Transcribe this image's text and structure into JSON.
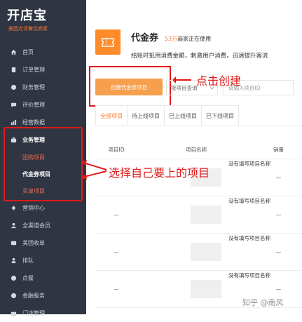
{
  "sidebar": {
    "logo": "开店宝",
    "logo_sub": "美团点评餐饮商家",
    "items": [
      {
        "label": "首页",
        "icon": "home-icon"
      },
      {
        "label": "订单管理",
        "icon": "order-icon"
      },
      {
        "label": "财务管理",
        "icon": "finance-icon"
      },
      {
        "label": "评价管理",
        "icon": "review-icon"
      },
      {
        "label": "经营数据",
        "icon": "chart-icon"
      },
      {
        "label": "业务管理",
        "icon": "business-icon"
      }
    ],
    "sub_items": [
      {
        "label": "团购项目"
      },
      {
        "label": "代金券项目"
      },
      {
        "label": "买单项目"
      }
    ],
    "items_after": [
      {
        "label": "营销中心",
        "icon": "marketing-icon"
      },
      {
        "label": "全渠道会员",
        "icon": "member-icon"
      },
      {
        "label": "美团收单",
        "icon": "pay-icon"
      },
      {
        "label": "排队",
        "icon": "queue-icon"
      },
      {
        "label": "点餐",
        "icon": "meal-icon"
      },
      {
        "label": "金融服务",
        "icon": "money-icon"
      },
      {
        "label": "门店管理",
        "icon": "store-icon"
      }
    ]
  },
  "header": {
    "title": "代金券",
    "count": "53万",
    "count_suffix": "商家正在使用",
    "desc": "结账时抵用消费金额，刺激用户消费，迅速提升客流"
  },
  "toolbar": {
    "create_label": "创建代金券项目",
    "status_select": "按项目查询",
    "id_placeholder": "请输入项目ID"
  },
  "tabs": [
    {
      "label": "全部项目",
      "active": true
    },
    {
      "label": "待上线项目"
    },
    {
      "label": "已上线项目"
    },
    {
      "label": "已下线项目"
    }
  ],
  "table": {
    "headers": [
      "项目ID",
      "项目名称",
      "销量"
    ],
    "rows": [
      {
        "id": "",
        "name": "没有填写项目名称",
        "sales": "—"
      },
      {
        "id": "—",
        "name": "没有填写项目名称",
        "sales": "—"
      },
      {
        "id": "—",
        "name": "没有填写项目名称",
        "sales": "—"
      },
      {
        "id": "—",
        "name": "没有填写项目名称",
        "sales": "—"
      }
    ]
  },
  "annotations": {
    "click_create": "点击创建",
    "choose_item": "选择自己要上的项目"
  },
  "watermark": "知乎 @南风",
  "colors": {
    "accent": "#ff7a2a",
    "annotation": "#e11a1a",
    "sidebar_bg": "#2f3542"
  }
}
